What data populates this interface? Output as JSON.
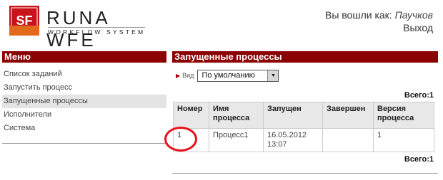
{
  "header": {
    "logo_word": "RUNA WFE",
    "logo_sub": "WORKFLOW SYSTEM",
    "logo_mark_text": "SF",
    "logged_in_label": "Вы вошли как:",
    "user_name": "Паучков",
    "logout_label": "Выход"
  },
  "sidebar": {
    "title": "Меню",
    "items": [
      {
        "label": "Список заданий"
      },
      {
        "label": "Запустить процесс"
      },
      {
        "label": "Запущенные процессы"
      },
      {
        "label": "Исполнители"
      },
      {
        "label": "Система"
      }
    ],
    "active_index": 2
  },
  "main": {
    "title": "Запущенные процессы",
    "view_label": "Вид",
    "view_selected": "По умолчанию",
    "total_label": "Всего:1",
    "columns": [
      "Номер",
      "Имя процесса",
      "Запущен",
      "Завершен",
      "Версия процесса"
    ],
    "rows": [
      {
        "number": "1",
        "name": "Процесс1",
        "started": "16.05.2012 13:07",
        "finished": "",
        "version": "1"
      }
    ]
  },
  "colors": {
    "accent": "#8b0000",
    "highlight_circle": "#e8101a",
    "active_menu_bg": "#e4e4e4"
  }
}
